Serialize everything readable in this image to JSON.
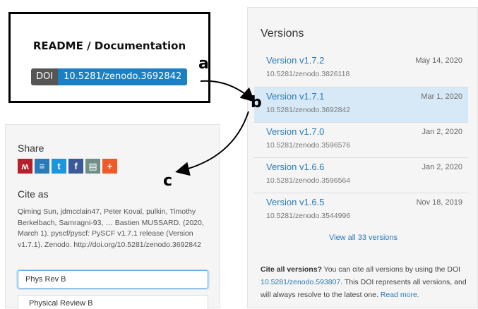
{
  "readme": {
    "title": "README / Documentation",
    "doi_label": "DOI",
    "doi_value": "10.5281/zenodo.3692842"
  },
  "annotations": {
    "a": "a",
    "b": "b",
    "c": "c"
  },
  "versions": {
    "title": "Versions",
    "items": [
      {
        "name": "Version v1.7.2",
        "doi": "10.5281/zenodo.3826118",
        "date": "May 14, 2020",
        "selected": false
      },
      {
        "name": "Version v1.7.1",
        "doi": "10.5281/zenodo.3692842",
        "date": "Mar 1, 2020",
        "selected": true
      },
      {
        "name": "Version v1.7.0",
        "doi": "10.5281/zenodo.3596576",
        "date": "Jan 2, 2020",
        "selected": false
      },
      {
        "name": "Version v1.6.6",
        "doi": "10.5281/zenodo.3596564",
        "date": "Jan 2, 2020",
        "selected": false
      },
      {
        "name": "Version v1.6.5",
        "doi": "10.5281/zenodo.3544996",
        "date": "Nov 18, 2019",
        "selected": false
      }
    ],
    "view_all": "View all 33 versions",
    "cite_all_bold": "Cite all versions?",
    "cite_all_text1": " You can cite all versions by using the DOI ",
    "cite_all_doi": "10.5281/zenodo.593807",
    "cite_all_text2": ". This DOI represents all versions, and will always resolve to the latest one. ",
    "read_more": "Read more."
  },
  "share": {
    "label": "Share",
    "icons": [
      {
        "name": "mendeley-icon",
        "glyph": "ʍ",
        "color": "#b61f2b"
      },
      {
        "name": "citeulike-icon",
        "glyph": "≡",
        "color": "#2a7ab8"
      },
      {
        "name": "twitter-icon",
        "glyph": "t",
        "color": "#1b95e0"
      },
      {
        "name": "facebook-icon",
        "glyph": "f",
        "color": "#3b5998"
      },
      {
        "name": "print-icon",
        "glyph": "▤",
        "color": "#6f8f86"
      },
      {
        "name": "more-icon",
        "glyph": "+",
        "color": "#f05a28"
      }
    ]
  },
  "cite": {
    "label": "Cite as",
    "citation": "Qiming Sun, jdmcclain47, Peter Koval, pulkin, Timothy Berkelbach, Samragni-93, … Bastien MUSSARD. (2020, March 1). pyscf/pyscf: PySCF v1.7.1 release (Version v1.7.1). Zenodo. http://doi.org/10.5281/zenodo.3692842",
    "style_input_value": "Phys Rev B",
    "dropdown_option": "Physical Review B"
  }
}
